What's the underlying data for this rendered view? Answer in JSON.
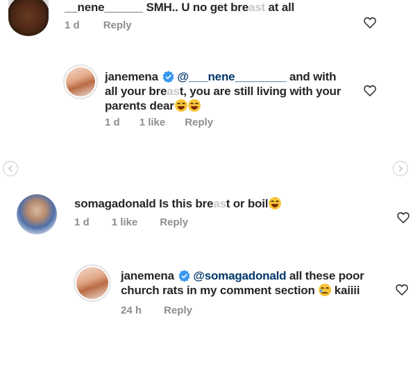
{
  "comments": [
    {
      "username": "__nene______",
      "text_before": "SMH.. U no get bre",
      "text_blur": "ast",
      "text_after": " at all",
      "time": "1 d",
      "reply": "Reply"
    },
    {
      "username": "janemena",
      "mention": "@___nene________",
      "line1_rest": " and with",
      "line2_before": "all your bre",
      "line2_blur": "as",
      "line2_after": "t, you are still living with your",
      "line3": "parents dear",
      "time": "1 d",
      "likes": "1 like",
      "reply": "Reply"
    },
    {
      "username": "somagadonald",
      "text_before": " Is this bre",
      "text_blur": "as",
      "text_after": "t or boil",
      "time": "1 d",
      "likes": "1 like",
      "reply": "Reply"
    },
    {
      "username": "janemena",
      "mention": "@somagadonald",
      "line1_rest": " all these poor",
      "line2": "church rats in my comment section ",
      "line2_after": " kaiiii",
      "time": "24 h",
      "reply": "Reply"
    }
  ],
  "colors": {
    "text": "#262626",
    "meta": "#8e8e8e",
    "mention": "#00376b",
    "verified": "#3897f0"
  },
  "icons": [
    "heart-icon",
    "verified-badge-icon",
    "chevron-left-icon",
    "chevron-right-icon",
    "laughing-emoji-icon",
    "sad-emoji-icon"
  ]
}
